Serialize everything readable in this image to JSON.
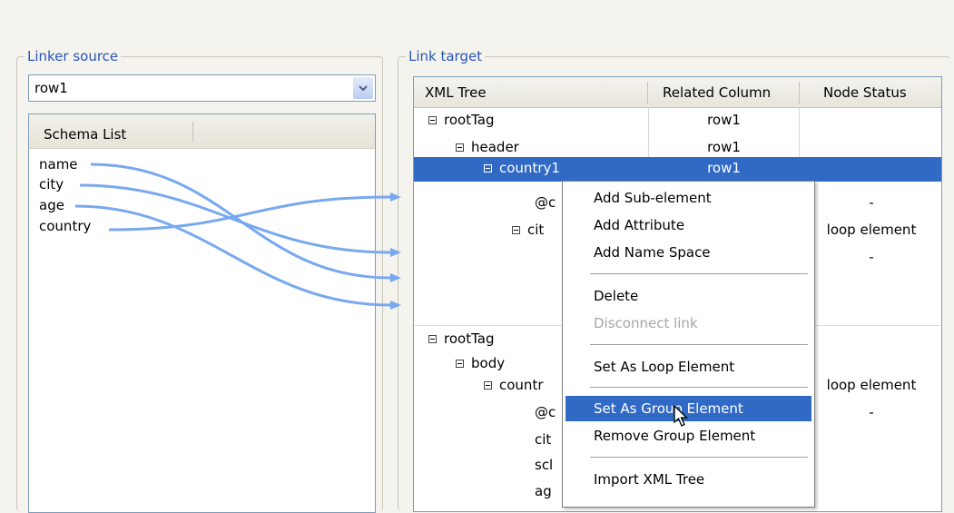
{
  "linker_source": {
    "title": "Linker source",
    "combo_value": "row1",
    "schema_header": "Schema List",
    "schema_items": [
      "name",
      "city",
      "age",
      "country"
    ]
  },
  "link_target": {
    "title": "Link target",
    "columns": [
      "XML Tree",
      "Related Column",
      "Node Status"
    ],
    "rows": [
      {
        "label": "rootTag",
        "related": "row1",
        "status": ""
      },
      {
        "label": "header",
        "related": "row1",
        "status": ""
      },
      {
        "label": "country1",
        "related": "row1",
        "status": ""
      },
      {
        "label": "@c",
        "related": "",
        "status": "-"
      },
      {
        "label": "cit",
        "related": "",
        "status": "loop element"
      },
      {
        "label": "",
        "related": "",
        "status": "-"
      },
      {
        "label": "",
        "related": "",
        "status": ""
      },
      {
        "label": "",
        "related": "",
        "status": ""
      },
      {
        "label": "rootTag",
        "related": "",
        "status": ""
      },
      {
        "label": "body",
        "related": "",
        "status": ""
      },
      {
        "label": "countr",
        "related": "",
        "status": "loop element"
      },
      {
        "label": "@c",
        "related": "",
        "status": "-"
      },
      {
        "label": "cit",
        "related": "",
        "status": ""
      },
      {
        "label": "scl",
        "related": "",
        "status": ""
      },
      {
        "label": "ag",
        "related": "",
        "status": ""
      }
    ]
  },
  "context_menu": {
    "items": [
      {
        "label": "Add Sub-element"
      },
      {
        "label": "Add Attribute"
      },
      {
        "label": "Add Name Space"
      },
      {
        "label": "Delete"
      },
      {
        "label": "Disconnect link"
      },
      {
        "label": "Set As Loop Element"
      },
      {
        "label": "Set As Group Element"
      },
      {
        "label": "Remove Group Element"
      },
      {
        "label": "Import XML Tree"
      }
    ]
  },
  "colors": {
    "selection": "#316ac5",
    "link_line": "#78a8f0",
    "group_title": "#2a56b8"
  }
}
